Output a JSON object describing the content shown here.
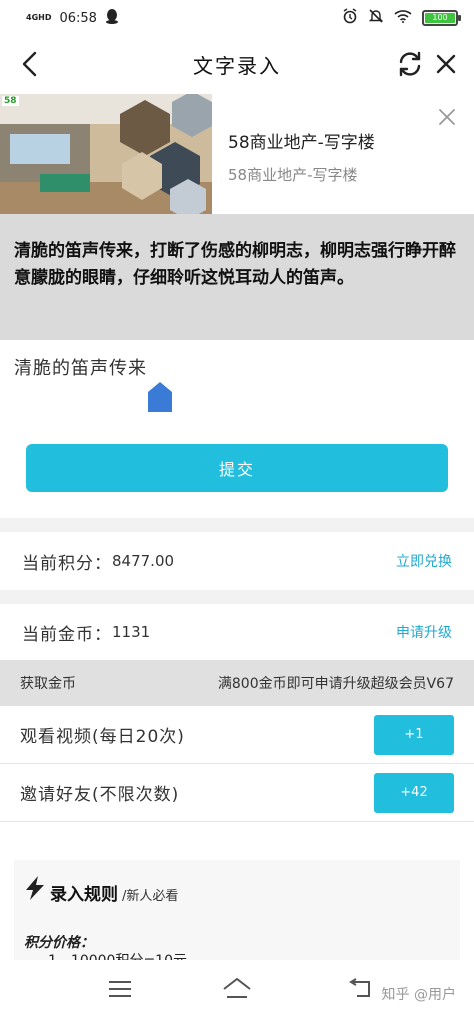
{
  "status_bar": {
    "network": "4GHD",
    "time": "06:58",
    "battery": "100"
  },
  "header": {
    "title": "文字录入"
  },
  "ad": {
    "badge": "58",
    "title": "58商业地产-写字楼",
    "subtitle": "58商业地产-写字楼"
  },
  "passage": {
    "text": "清脆的笛声传来，打断了伤感的柳明志，柳明志强行睁开醉意朦胧的眼睛，仔细聆听这悦耳动人的笛声。"
  },
  "input": {
    "value": "清脆的笛声传来"
  },
  "submit": {
    "label": "提交"
  },
  "points": {
    "label": "当前积分：",
    "value": "8477.00",
    "action": "立即兑换"
  },
  "coins": {
    "label": "当前金币：",
    "value": "1131",
    "action": "申请升级"
  },
  "earn": {
    "title": "获取金币",
    "note": "满800金币即可申请升级超级会员V67",
    "tasks": [
      {
        "label": "观看视频(每日20次)",
        "button": "+1"
      },
      {
        "label": "邀请好友(不限次数)",
        "button": "+42"
      }
    ]
  },
  "rules": {
    "title": "录入规则",
    "subtitle": "新人必看",
    "price_label": "积分价格：",
    "item_1": "1、10000积分=10元"
  },
  "nav": {
    "watermark": "知乎 @用户"
  },
  "colors": {
    "accent": "#22bedd",
    "link": "#22aacc",
    "passage_bg": "#dadada"
  }
}
